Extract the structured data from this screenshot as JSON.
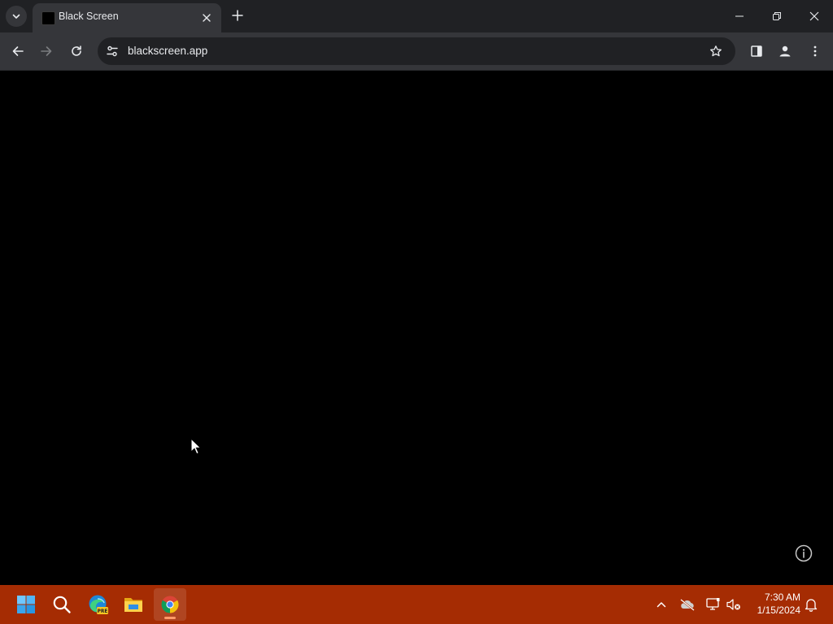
{
  "browser": {
    "tab": {
      "title": "Black Screen"
    },
    "address_bar": {
      "url": "blackscreen.app"
    }
  },
  "taskbar": {
    "apps": [
      "start",
      "search",
      "edge-beta",
      "file-explorer",
      "chrome"
    ],
    "edge_badge": "PRE",
    "clock": {
      "time": "7:30 AM",
      "date": "1/15/2024"
    }
  },
  "colors": {
    "titlebar": "#202124",
    "toolbar": "#35363a",
    "page_background": "#000000",
    "taskbar": "#a52c03"
  },
  "icons": {
    "tab_search": "chevron-down-icon",
    "close_tab": "close-icon",
    "new_tab": "plus-icon",
    "back": "arrow-left-icon",
    "forward": "arrow-right-icon",
    "reload": "reload-icon",
    "site_info": "tune-icon",
    "bookmark": "star-icon",
    "side_panel": "side-panel-icon",
    "profile": "profile-icon",
    "menu": "kebab-menu-icon",
    "info": "info-icon"
  }
}
